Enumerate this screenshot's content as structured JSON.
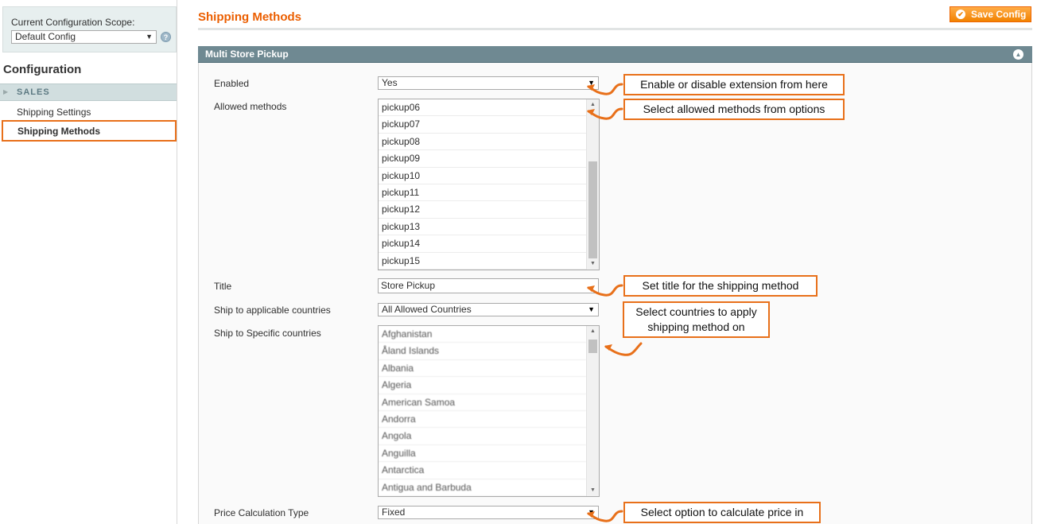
{
  "sidebar": {
    "scope_label": "Current Configuration Scope:",
    "scope_value": "Default Config",
    "help_icon": "?",
    "config_title": "Configuration",
    "group_label": "SALES",
    "items": [
      "Shipping Settings",
      "Shipping Methods"
    ],
    "active_item": "Shipping Methods"
  },
  "header": {
    "title": "Shipping Methods",
    "save_label": "Save Config"
  },
  "section": {
    "title": "Multi Store Pickup",
    "fields": {
      "enabled": {
        "label": "Enabled",
        "value": "Yes"
      },
      "allowed_methods": {
        "label": "Allowed methods",
        "options": [
          "pickup06",
          "pickup07",
          "pickup08",
          "pickup09",
          "pickup10",
          "pickup11",
          "pickup12",
          "pickup13",
          "pickup14",
          "pickup15"
        ]
      },
      "title": {
        "label": "Title",
        "value": "Store Pickup"
      },
      "ship_applicable": {
        "label": "Ship to applicable countries",
        "value": "All Allowed Countries"
      },
      "ship_specific": {
        "label": "Ship to Specific countries",
        "options": [
          "Afghanistan",
          "Åland Islands",
          "Albania",
          "Algeria",
          "American Samoa",
          "Andorra",
          "Angola",
          "Anguilla",
          "Antarctica",
          "Antigua and Barbuda"
        ]
      },
      "price_calc": {
        "label": "Price Calculation Type",
        "value": "Fixed"
      }
    }
  },
  "callouts": {
    "enabled": "Enable or disable extension from here",
    "allowed": "Select allowed methods from options",
    "title": "Set title for the shipping method",
    "countries_line1": "Select countries to apply",
    "countries_line2": "shipping method on",
    "price": "Select option to calculate price in"
  },
  "colors": {
    "accent": "#eb5e00",
    "callout_border": "#e8701a",
    "section_header": "#6f8992"
  }
}
